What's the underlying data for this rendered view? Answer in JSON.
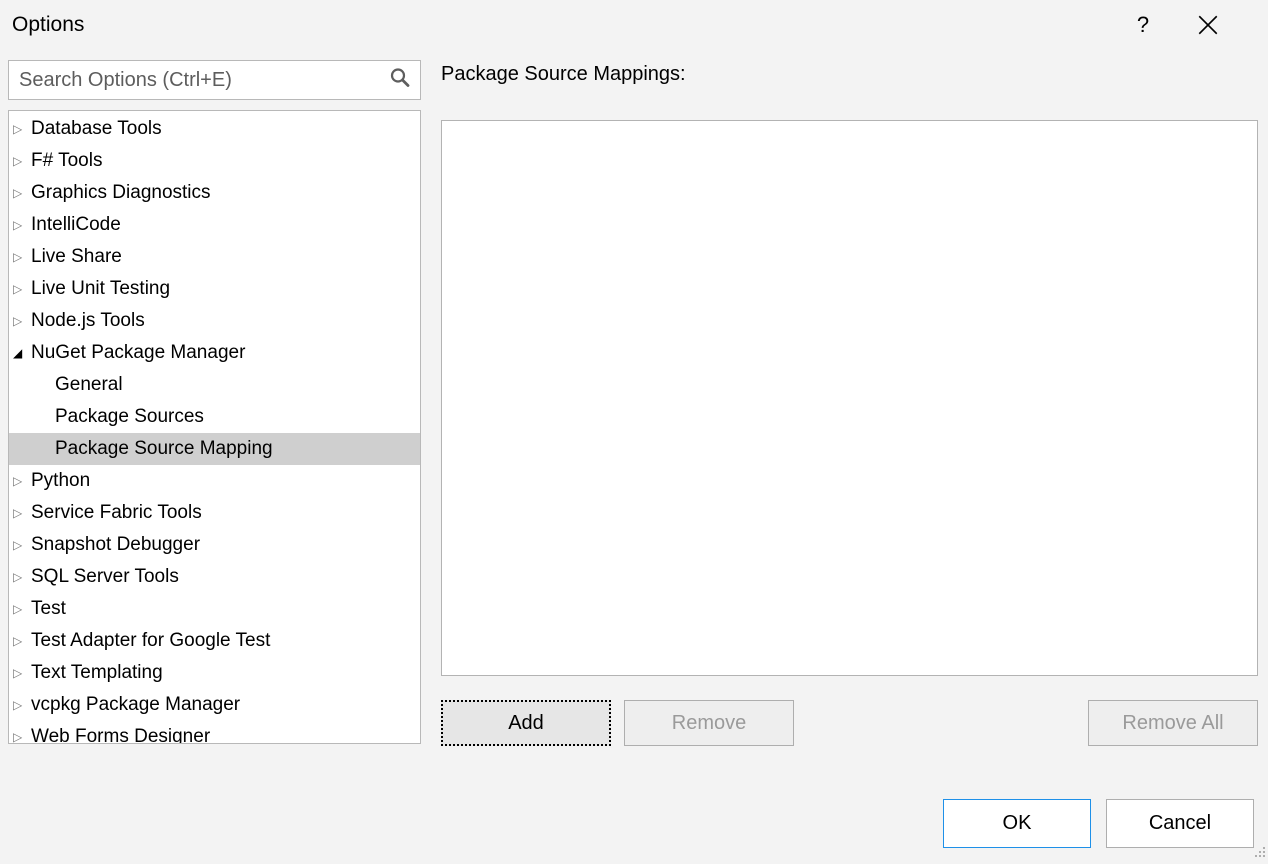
{
  "title": "Options",
  "search": {
    "placeholder": "Search Options (Ctrl+E)"
  },
  "tree": {
    "items": [
      {
        "label": "Database Tools",
        "expanded": false
      },
      {
        "label": "F# Tools",
        "expanded": false
      },
      {
        "label": "Graphics Diagnostics",
        "expanded": false
      },
      {
        "label": "IntelliCode",
        "expanded": false
      },
      {
        "label": "Live Share",
        "expanded": false
      },
      {
        "label": "Live Unit Testing",
        "expanded": false
      },
      {
        "label": "Node.js Tools",
        "expanded": false
      },
      {
        "label": "NuGet Package Manager",
        "expanded": true,
        "children": [
          {
            "label": "General",
            "selected": false
          },
          {
            "label": "Package Sources",
            "selected": false
          },
          {
            "label": "Package Source Mapping",
            "selected": true
          }
        ]
      },
      {
        "label": "Python",
        "expanded": false
      },
      {
        "label": "Service Fabric Tools",
        "expanded": false
      },
      {
        "label": "Snapshot Debugger",
        "expanded": false
      },
      {
        "label": "SQL Server Tools",
        "expanded": false
      },
      {
        "label": "Test",
        "expanded": false
      },
      {
        "label": "Test Adapter for Google Test",
        "expanded": false
      },
      {
        "label": "Text Templating",
        "expanded": false
      },
      {
        "label": "vcpkg Package Manager",
        "expanded": false
      },
      {
        "label": "Web Forms Designer",
        "expanded": false
      }
    ]
  },
  "right_panel": {
    "label": "Package Source Mappings:"
  },
  "buttons": {
    "add": "Add",
    "remove": "Remove",
    "remove_all": "Remove All",
    "ok": "OK",
    "cancel": "Cancel"
  }
}
